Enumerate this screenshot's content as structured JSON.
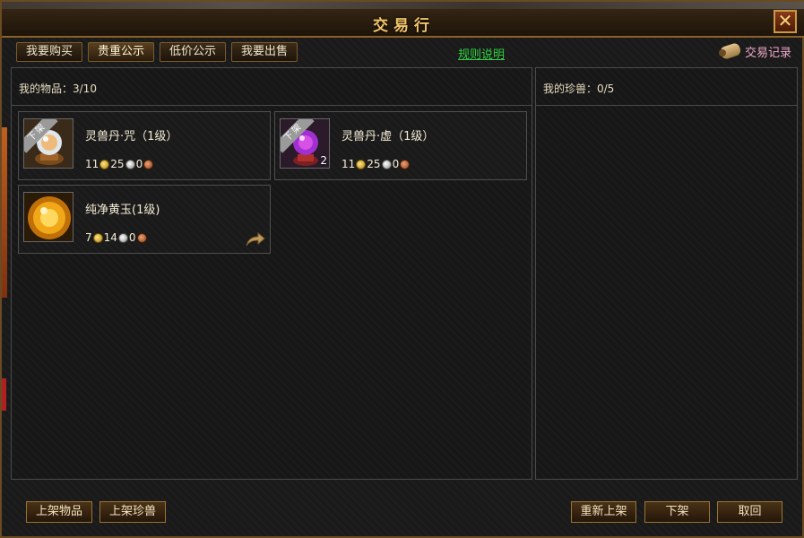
{
  "window": {
    "title": "交易行",
    "close_symbol": "✕"
  },
  "tabs": [
    {
      "label": "我要购买",
      "active": false
    },
    {
      "label": "贵重公示",
      "active": true
    },
    {
      "label": "低价公示",
      "active": false
    },
    {
      "label": "我要出售",
      "active": false
    }
  ],
  "rules_link": "规则说明",
  "records": {
    "label": "交易记录",
    "icon": "scroll-icon"
  },
  "left_panel": {
    "header": "我的物品：3/10"
  },
  "right_panel": {
    "header": "我的珍兽：0/5"
  },
  "items": [
    {
      "name": "灵兽丹·咒（1级）",
      "badge": "下架",
      "quantity": "",
      "price": {
        "gold": "11",
        "silver": "25",
        "copper": "0"
      },
      "icon": "orb-crystal-icon",
      "accent": "#e8e4d8"
    },
    {
      "name": "灵兽丹·虚（1级）",
      "badge": "下架",
      "quantity": "2",
      "price": {
        "gold": "11",
        "silver": "25",
        "copper": "0"
      },
      "icon": "orb-purple-icon",
      "accent": "#b84ad8"
    },
    {
      "name": "纯净黄玉(1级)",
      "badge": "",
      "quantity": "",
      "price": {
        "gold": "7",
        "silver": "14",
        "copper": "0"
      },
      "icon": "topaz-gem-icon",
      "accent": "#e8a010"
    }
  ],
  "buttons": {
    "list_item": "上架物品",
    "list_pet": "上架珍兽",
    "relist": "重新上架",
    "delist": "下架",
    "cancel": "取回"
  }
}
